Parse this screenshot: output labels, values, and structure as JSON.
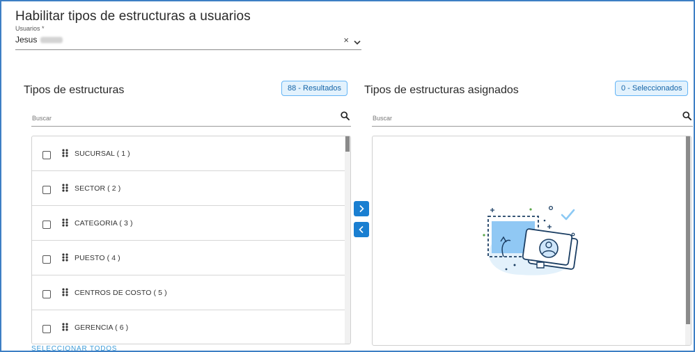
{
  "page": {
    "title": "Habilitar tipos de estructuras a usuarios"
  },
  "user_field": {
    "label": "Usuarios *",
    "value": "Jesus",
    "clear_glyph": "×"
  },
  "available": {
    "title": "Tipos de estructuras",
    "badge": "88 - Resultados",
    "search_placeholder": "Buscar",
    "items": [
      {
        "label": "SUCURSAL ( 1 )",
        "checked": false
      },
      {
        "label": "SECTOR ( 2 )",
        "checked": false
      },
      {
        "label": "CATEGORIA ( 3 )",
        "checked": false
      },
      {
        "label": "PUESTO ( 4 )",
        "checked": false
      },
      {
        "label": "CENTROS DE COSTO ( 5 )",
        "checked": false
      },
      {
        "label": "GERENCIA ( 6 )",
        "checked": false
      }
    ],
    "select_all": "SELECCIONAR TODOS"
  },
  "assigned": {
    "title": "Tipos de estructuras asignados",
    "badge": "0 - Seleccionados",
    "search_placeholder": "Buscar",
    "empty_illustration": "drag-to-assign-illustration"
  },
  "icons": {
    "search": "search-icon",
    "dropdown": "chevron-down-icon",
    "drag": "drag-handle-icon",
    "move_right": "chevron-right-icon",
    "move_left": "chevron-left-icon"
  },
  "colors": {
    "accent": "#1a7fd1",
    "badge_bg": "#e3f2fd",
    "badge_border": "#64b5f6",
    "link": "#3b9bd8",
    "frame_border": "#3d7fc4"
  }
}
